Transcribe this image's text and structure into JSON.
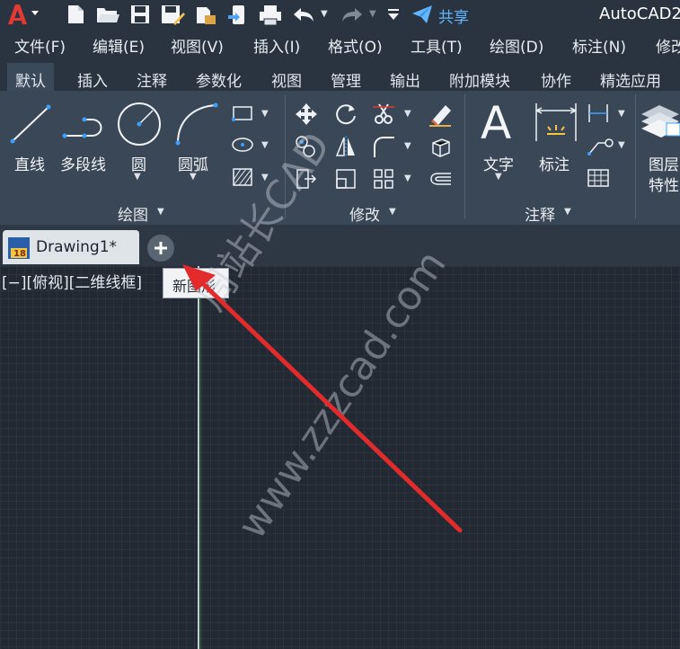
{
  "titlebar": {
    "app_title": "AutoCAD2",
    "share_label": "共享",
    "colors": {
      "logo": "#e53935",
      "share": "#62b6ff"
    }
  },
  "menubar": {
    "items": [
      "文件(F)",
      "编辑(E)",
      "视图(V)",
      "插入(I)",
      "格式(O)",
      "工具(T)",
      "绘图(D)",
      "标注(N)",
      "修改"
    ]
  },
  "ribbon_tabs": {
    "items": [
      "默认",
      "插入",
      "注释",
      "参数化",
      "视图",
      "管理",
      "输出",
      "附加模块",
      "协作",
      "精选应用"
    ],
    "active": "默认"
  },
  "ribbon": {
    "draw": {
      "line": "直线",
      "polyline": "多段线",
      "circle": "圆",
      "arc": "圆弧",
      "title": "绘图"
    },
    "modify": {
      "title": "修改"
    },
    "annotation": {
      "text": "文字",
      "dimension": "标注",
      "title": "注释"
    },
    "layers": {
      "line1": "图层",
      "line2": "特性"
    }
  },
  "doc": {
    "tab_label": "Drawing1*",
    "new_tooltip": "新图形",
    "viewport_label": "[−][俯视][二维线框]",
    "file_icon_text": "18"
  },
  "watermark": {
    "line1": "周站长CAD",
    "line2": "www.zzzcad.com"
  }
}
